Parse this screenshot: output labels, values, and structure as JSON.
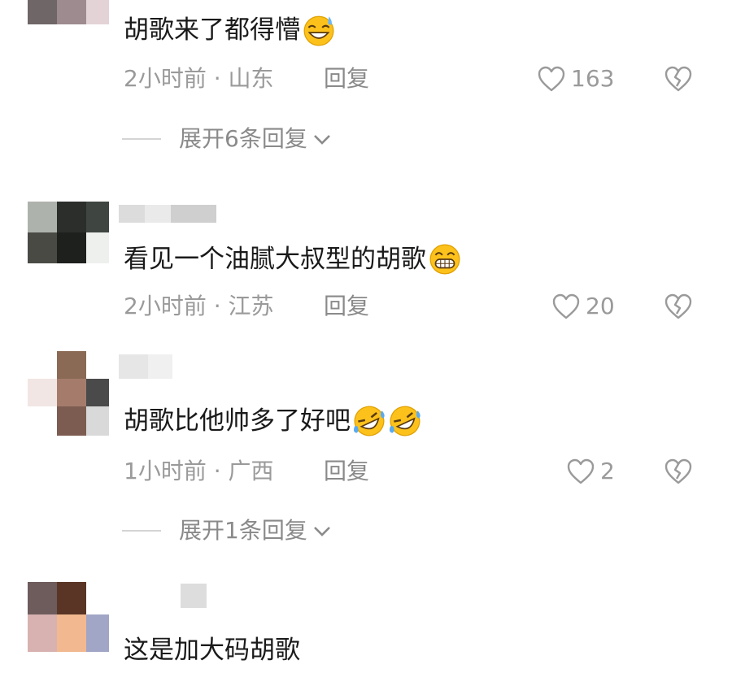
{
  "comments": [
    {
      "text": "胡歌来了都得懵",
      "emoji": "sweat-smile-emoji",
      "time": "2小时前 · 山东",
      "reply": "回复",
      "likes": "163",
      "expand": "展开6条回复"
    },
    {
      "text": "看见一个油腻大叔型的胡歌",
      "emoji": "grin-emoji",
      "time": "2小时前 · 江苏",
      "reply": "回复",
      "likes": "20"
    },
    {
      "text": "胡歌比他帅多了好吧",
      "emoji": "rofl-emoji",
      "time": "1小时前 · 广西",
      "reply": "回复",
      "likes": "2",
      "expand": "展开1条回复"
    },
    {
      "text": "这是加大码胡歌"
    }
  ],
  "icons": {
    "like": "heart-outline-icon",
    "dislike": "broken-heart-icon",
    "expand": "chevron-down-icon"
  },
  "colors": {
    "text": "#1a1a1a",
    "meta": "#9a9a9a",
    "emoji_face": "#fcc21b"
  }
}
